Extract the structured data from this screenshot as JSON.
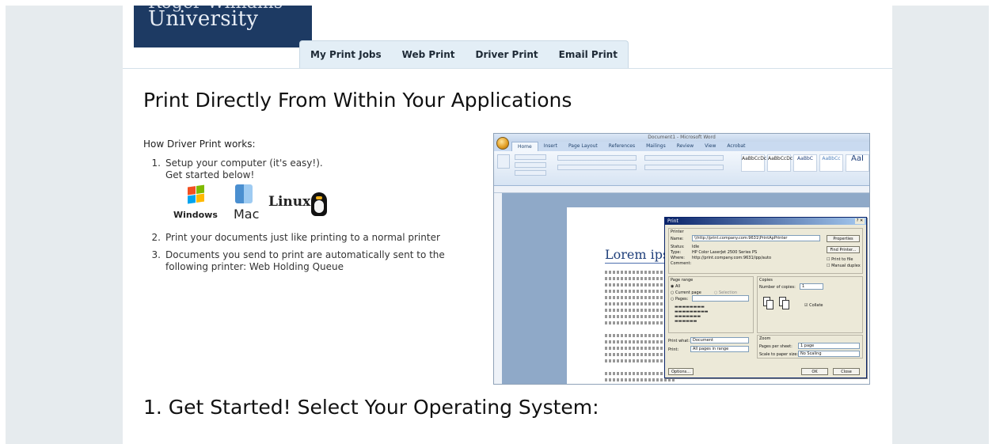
{
  "header": {
    "logo_top": "Roger Williams",
    "logo_main": "University",
    "tabs": [
      "My Print Jobs",
      "Web Print",
      "Driver Print",
      "Email Print"
    ]
  },
  "main": {
    "title": "Print Directly From Within Your Applications",
    "how_title": "How Driver Print works:",
    "steps": [
      {
        "num": "1.",
        "line1": "Setup your computer (it's easy!).",
        "line2": "Get started below!"
      },
      {
        "num": "2.",
        "line1": "Print your documents just like printing to a normal printer",
        "line2": ""
      },
      {
        "num": "3.",
        "line1": "Documents you send to print are automatically sent to the",
        "line2": "following printer: Web Holding Queue"
      }
    ],
    "os_logos": {
      "windows": "Windows",
      "mac": "Mac",
      "linux": "Linux"
    },
    "section_title": "1. Get Started! Select Your Operating System:"
  },
  "word_screenshot": {
    "window_title": "Document1 - Microsoft Word",
    "menu": [
      "Home",
      "Insert",
      "Page Layout",
      "References",
      "Mailings",
      "Review",
      "View",
      "Acrobat"
    ],
    "styles": [
      "AaBbCcDc",
      "AaBbCcDc",
      "AaBbC",
      "AaBbCc",
      "AaI"
    ],
    "doc_heading": "Lorem ipsu",
    "dialog": {
      "title": "Print",
      "printer_label": "Printer",
      "name_label": "Name:",
      "name_value": "\\\\http://print.company.com:9631\\PrintApPrinter",
      "status_label": "Status:",
      "status_value": "Idle",
      "type_label": "Type:",
      "type_value": "HP Color LaserJet 2500 Series PS",
      "where_label": "Where:",
      "where_value": "http://print.company.com:9631/ipp/auto",
      "comment_label": "Comment:",
      "properties_btn": "Properties",
      "find_btn": "Find Printer...",
      "print_to_file": "Print to file",
      "manual_duplex": "Manual duplex",
      "page_range": "Page range",
      "all": "All",
      "current_page": "Current page",
      "selection": "Selection",
      "pages": "Pages:",
      "copies": "Copies",
      "num_copies_label": "Number of copies:",
      "num_copies": "1",
      "collate": "Collate",
      "print_what_label": "Print what:",
      "print_what": "Document",
      "print_label": "Print:",
      "print_value": "All pages in range",
      "zoom": "Zoom",
      "pages_per_sheet_label": "Pages per sheet:",
      "pages_per_sheet": "1 page",
      "scale_label": "Scale to paper size:",
      "scale": "No Scaling",
      "options_btn": "Options...",
      "ok_btn": "OK",
      "close_btn": "Close"
    }
  }
}
